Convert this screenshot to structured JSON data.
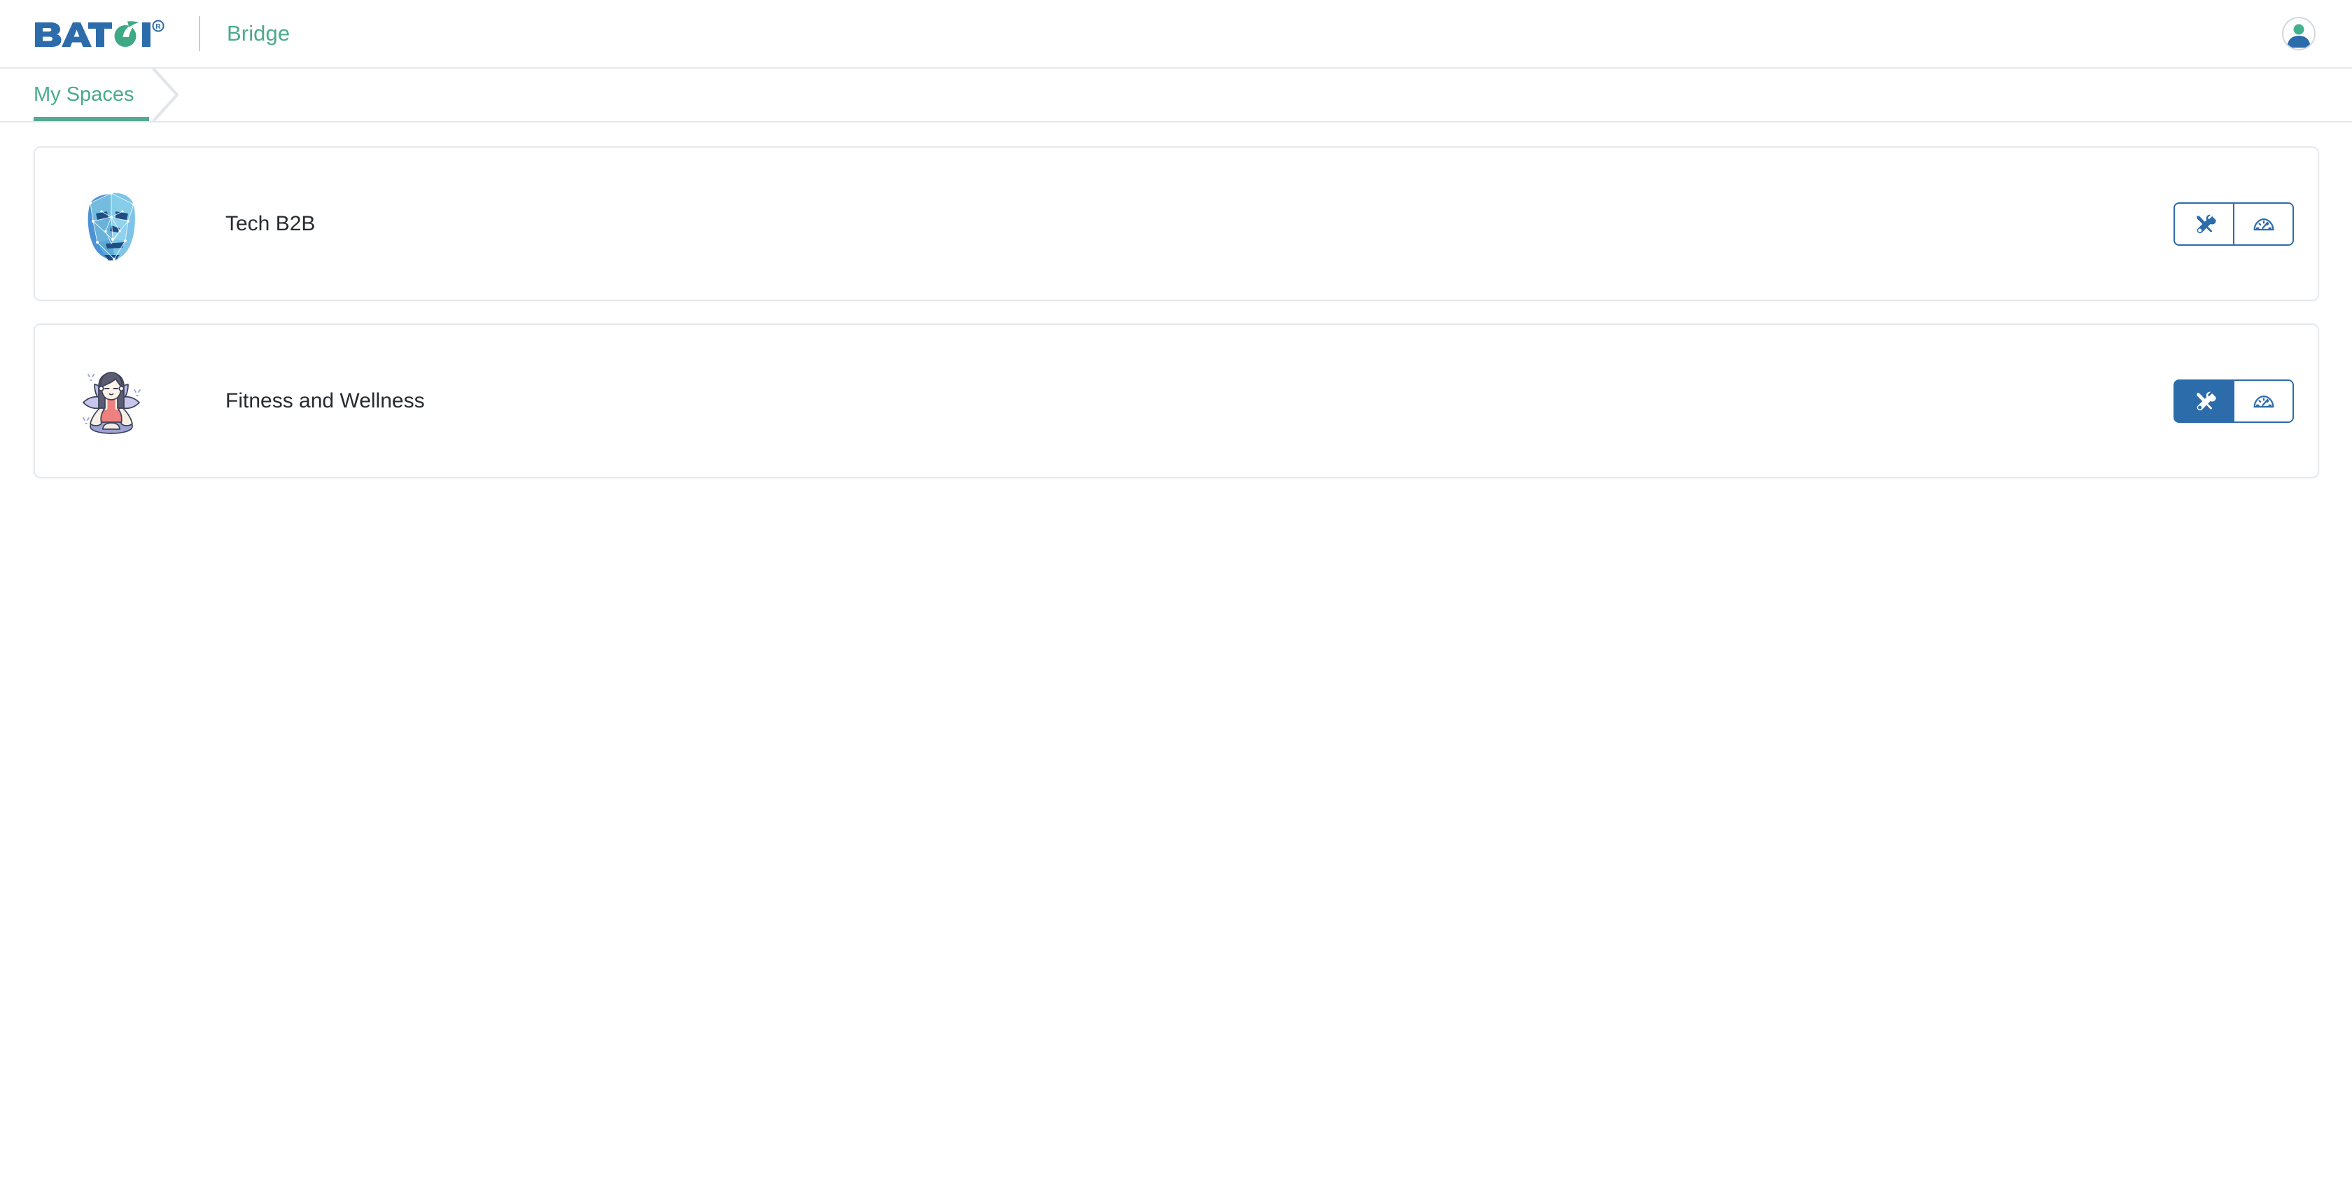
{
  "header": {
    "brand_name": "BATOI",
    "brand_registered_mark": "®",
    "product_name": "Bridge",
    "avatar_icon": "user-avatar-icon"
  },
  "breadcrumb": {
    "items": [
      {
        "label": "My Spaces",
        "active": true
      }
    ],
    "separator_icon": "chevron-right-icon"
  },
  "spaces": {
    "cards": [
      {
        "title": "Tech B2B",
        "thumbnail_icon": "low-poly-face-mask-icon",
        "actions": [
          {
            "icon": "tools-icon",
            "label": "Tools",
            "active": false
          },
          {
            "icon": "dashboard-gauge-icon",
            "label": "Dashboard",
            "active": false
          }
        ]
      },
      {
        "title": "Fitness and Wellness",
        "thumbnail_icon": "yoga-lotus-meditation-icon",
        "actions": [
          {
            "icon": "tools-icon",
            "label": "Tools",
            "active": true
          },
          {
            "icon": "dashboard-gauge-icon",
            "label": "Dashboard",
            "active": false
          }
        ]
      }
    ]
  },
  "colors": {
    "brand_blue": "#2c6cab",
    "brand_green": "#4aab8c",
    "accent_underline": "#55a894",
    "card_border": "#e6e9ec",
    "text_primary": "#262b2f"
  }
}
